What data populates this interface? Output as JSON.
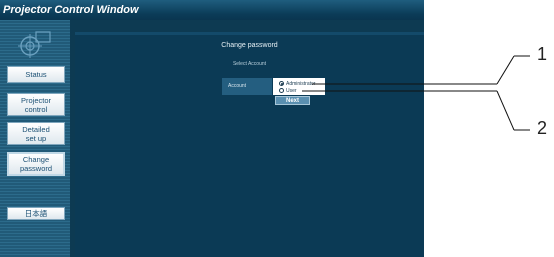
{
  "window": {
    "title": "Projector Control Window"
  },
  "sidebar": {
    "items": [
      {
        "label": "Status"
      },
      {
        "label": "Projector\ncontrol"
      },
      {
        "label": "Detailed\nset up"
      },
      {
        "label": "Change\npassword"
      },
      {
        "label": "日本語"
      }
    ]
  },
  "main": {
    "title": "Change password",
    "section_label": "Select Account",
    "field_label": "Account",
    "options": [
      {
        "label": "Administrator",
        "selected": true
      },
      {
        "label": "User",
        "selected": false
      }
    ],
    "next_label": "Next"
  },
  "callouts": [
    "1",
    "2"
  ],
  "colors": {
    "window_bg": "#0d3a52",
    "sidebar_bg": "#245e80",
    "button_text": "#1a4f73"
  }
}
